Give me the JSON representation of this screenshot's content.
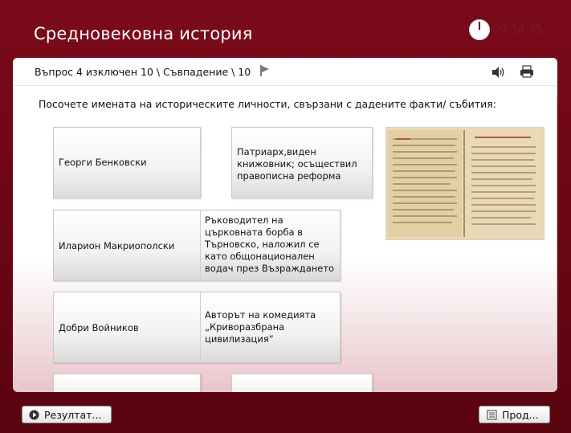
{
  "app": {
    "title": "Средновековна история",
    "timer": "00:14:35"
  },
  "header": {
    "question_label": "Въпрос 4 изключен 10 \\ Съвпадение \\ 10"
  },
  "instruction": "Посочете имената на историческите личности, свързани с дадените факти/ събития:",
  "matching": {
    "names": [
      "Георги Бенковски",
      "Иларион Макриополски",
      "Добри Войников"
    ],
    "facts": [
      "Патриарх,виден книжовник; осъществил правописна реформа",
      "Ръководител на църковната борба в Търновско, наложил се като общонационален водач през Възраждането",
      "Авторът на комедията „Криворазбрана цивилизация”"
    ]
  },
  "footer": {
    "result_button": "Резултат...",
    "next_button": "Прод..."
  },
  "colors": {
    "brand": "#6a0614",
    "panel": "#ffffff"
  }
}
